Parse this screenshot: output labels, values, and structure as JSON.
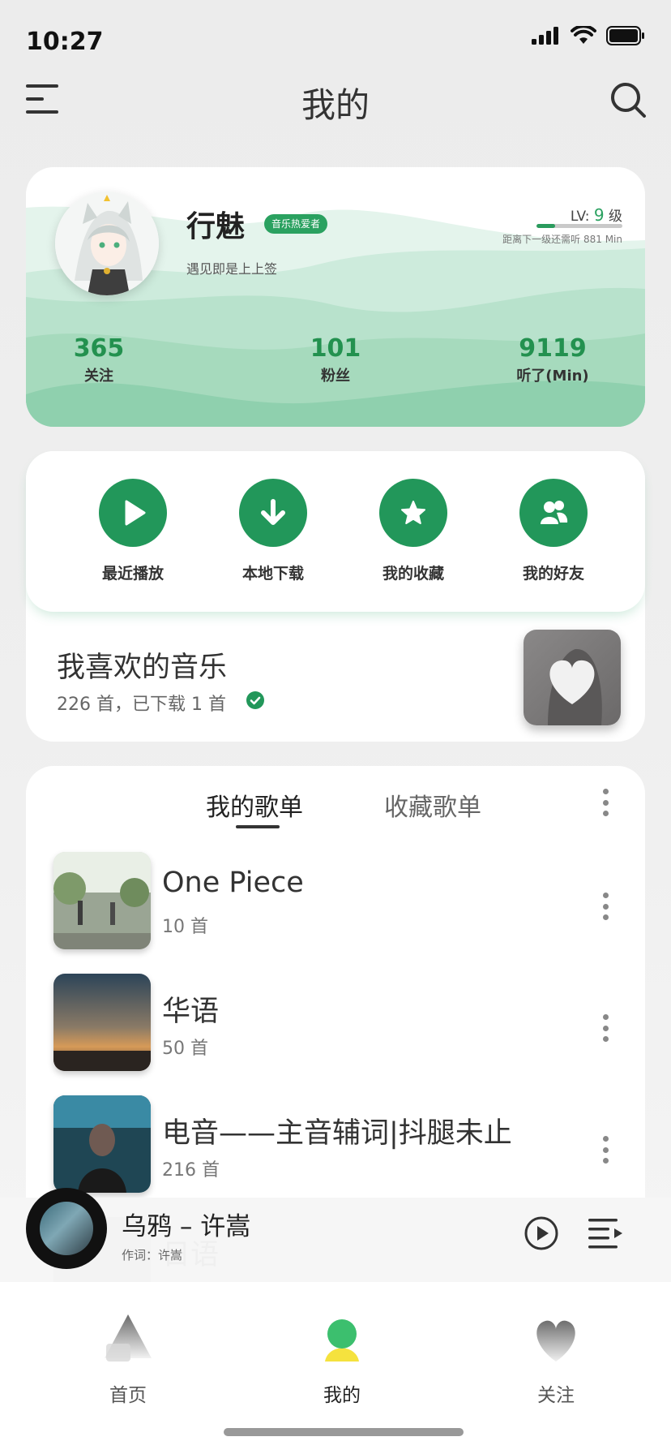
{
  "status_bar": {
    "time": "10:27"
  },
  "header": {
    "title": "我的"
  },
  "profile": {
    "name": "行魅",
    "badge": "音乐热爱者",
    "bio": "遇见即是上上签",
    "level_prefix": "LV:",
    "level_num": "9",
    "level_suffix": "级",
    "level_progress": 0.22,
    "level_note": "距离下一级还需听 881 Min",
    "stats": [
      {
        "value": "365",
        "label": "关注"
      },
      {
        "value": "101",
        "label": "粉丝"
      },
      {
        "value": "9119",
        "label": "听了(Min)"
      }
    ]
  },
  "actions": [
    {
      "label": "最近播放",
      "icon": "play-icon"
    },
    {
      "label": "本地下载",
      "icon": "download-icon"
    },
    {
      "label": "我的收藏",
      "icon": "star-icon"
    },
    {
      "label": "我的好友",
      "icon": "friends-icon"
    }
  ],
  "favorite": {
    "title": "我喜欢的音乐",
    "subtitle": "226 首，已下载 1 首"
  },
  "playlists": {
    "tabs": [
      "我的歌单",
      "收藏歌单"
    ],
    "items": [
      {
        "name": "One Piece",
        "count": "10 首"
      },
      {
        "name": "华语",
        "count": "50 首"
      },
      {
        "name": "电音——主音辅词|抖腿未止",
        "count": "216 首"
      },
      {
        "name": "日语"
      }
    ]
  },
  "now_playing": {
    "title": "乌鸦 – 许嵩",
    "subtitle": "作词：许嵩"
  },
  "bottom_nav": [
    {
      "label": "首页"
    },
    {
      "label": "我的"
    },
    {
      "label": "关注"
    }
  ],
  "colors": {
    "accent": "#22975a",
    "wave_light": "#cdebdc",
    "wave_dark": "#8fd0ae"
  }
}
